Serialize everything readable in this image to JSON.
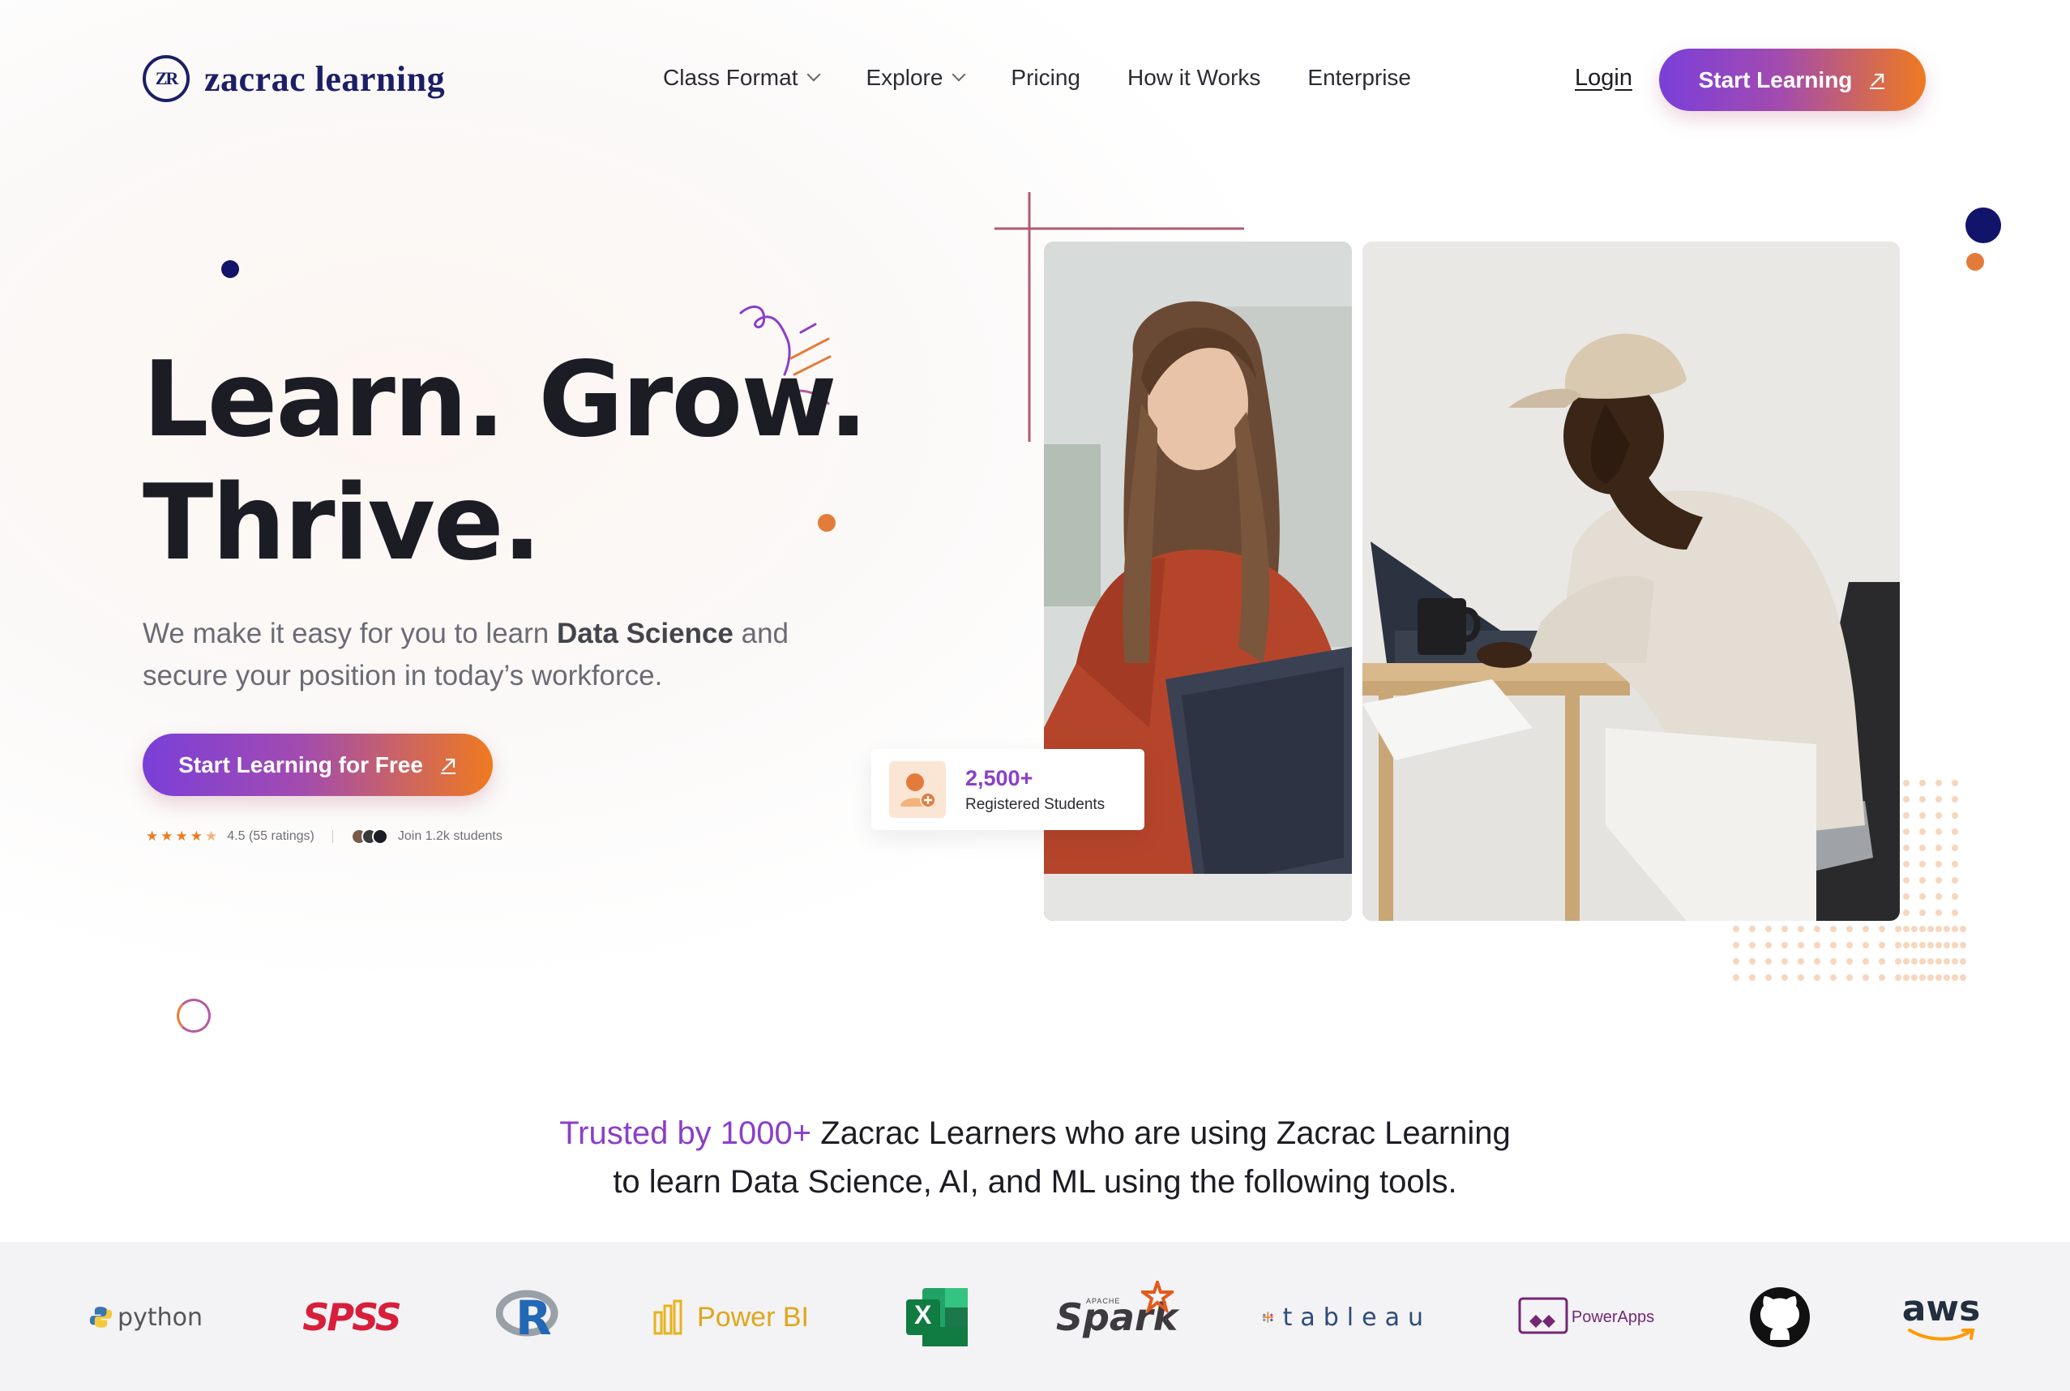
{
  "brand": {
    "name": "zacrac learning",
    "mark": "ZR"
  },
  "nav": {
    "items": [
      {
        "label": "Class Format",
        "dropdown": true
      },
      {
        "label": "Explore",
        "dropdown": true
      },
      {
        "label": "Pricing",
        "dropdown": false
      },
      {
        "label": "How it Works",
        "dropdown": false
      },
      {
        "label": "Enterprise",
        "dropdown": false
      }
    ],
    "login": "Login",
    "cta": "Start Learning"
  },
  "hero": {
    "headline_line1": "Learn. Grow.",
    "headline_line2": "Thrive.",
    "sub_pre": "We make it easy for you to learn ",
    "sub_bold": "Data Science",
    "sub_post": " and secure your position in today’s workforce.",
    "cta": "Start Learning for Free",
    "rating": "4.5 (55 ratings)",
    "rating_value": 4.5,
    "join": "Join 1.2k students"
  },
  "stat": {
    "number": "2,500+",
    "label": "Registered Students"
  },
  "trusted": {
    "highlight": "Trusted by 1000+",
    "line1_rest": " Zacrac Learners who are using Zacrac Learning",
    "line2": "to learn Data Science, AI, and ML using the following tools."
  },
  "tools": [
    {
      "name": "python",
      "icon": "python-logo"
    },
    {
      "name": "SPSS",
      "icon": "spss-logo"
    },
    {
      "name": "R",
      "icon": "r-logo"
    },
    {
      "name": "Power BI",
      "icon": "powerbi-logo"
    },
    {
      "name": "X",
      "icon": "excel-logo"
    },
    {
      "name": "Spark",
      "icon": "spark-logo",
      "tag": "APACHE"
    },
    {
      "name": "tableau",
      "icon": "tableau-logo"
    },
    {
      "name": "PowerApps",
      "icon": "powerapps-logo"
    },
    {
      "name": "GitHub",
      "icon": "github-logo"
    },
    {
      "name": "aws",
      "icon": "aws-logo"
    }
  ],
  "colors": {
    "navy": "#1c1f66",
    "purple": "#8a3fc8",
    "orange": "#ef7a1f",
    "gradient_start": "#7a3fd9",
    "gradient_end": "#ef7a1f"
  }
}
